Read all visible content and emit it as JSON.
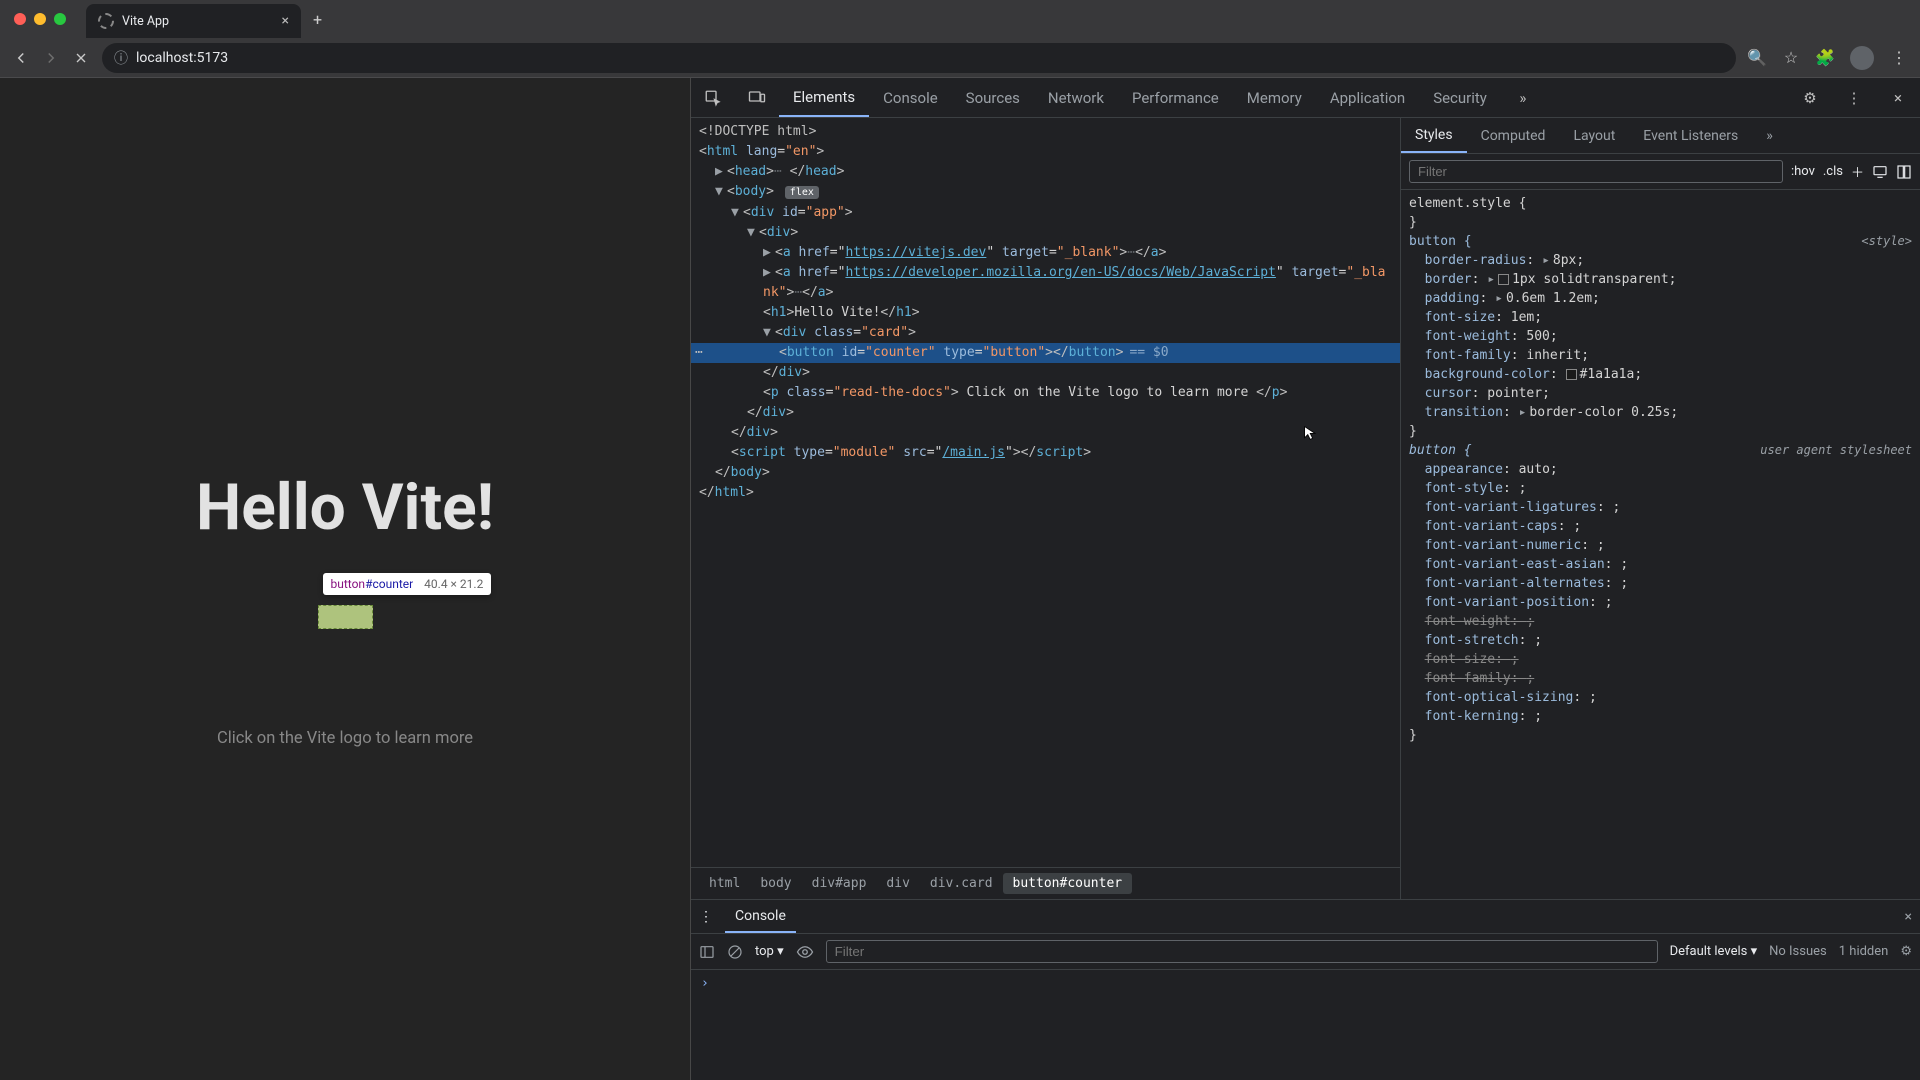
{
  "browser": {
    "window_title": "Vite App",
    "url": "localhost:5173",
    "traffic_light_colors": [
      "#ff5f57",
      "#febc2e",
      "#28c840"
    ]
  },
  "page": {
    "heading": "Hello Vite!",
    "footer": "Click on the Vite logo to learn more",
    "inspect_tooltip_name": "button",
    "inspect_tooltip_id": "#counter",
    "inspect_tooltip_dims": "40.4 × 21.2"
  },
  "devtools": {
    "tabs": [
      "Elements",
      "Console",
      "Sources",
      "Network",
      "Performance",
      "Memory",
      "Application",
      "Security"
    ],
    "active_tab": "Elements",
    "breadcrumb": [
      "html",
      "body",
      "div#app",
      "div",
      "div.card",
      "button#counter"
    ],
    "breadcrumb_active": 5,
    "selected_line_suffix": "== $0",
    "dom": {
      "doctype": "<!DOCTYPE html>",
      "html_open": "<html lang=\"en\">",
      "head": {
        "open": "<head>",
        "close": "</head>"
      },
      "body_open": "<body>",
      "body_badge": "flex",
      "app_open": "<div id=\"app\">",
      "div_open": "<div>",
      "link1_href": "https://vitejs.dev",
      "link2_href": "https://developer.mozilla.org/en-US/docs/Web/JavaScript",
      "target": "_blank",
      "h1_text": "Hello Vite!",
      "card_open": "<div class=\"card\">",
      "button_line": "<button id=\"counter\" type=\"button\"></button>",
      "card_close": "</div>",
      "p_class": "read-the-docs",
      "p_text": "Click on the Vite logo to learn more",
      "div_close": "</div>",
      "script_type": "module",
      "script_src": "/main.js",
      "body_close": "</body>",
      "html_close": "</html>"
    }
  },
  "styles": {
    "tabs": [
      "Styles",
      "Computed",
      "Layout",
      "Event Listeners"
    ],
    "active_tab": "Styles",
    "filter_placeholder": "Filter",
    "toolbar_items": [
      ":hov",
      ".cls"
    ],
    "element_style": "element.style {",
    "rule_button": {
      "selector": "button {",
      "source": "<style>",
      "props": [
        {
          "p": "border-radius",
          "v": "8px",
          "arr": true
        },
        {
          "p": "border",
          "v": "1px solid",
          "arr": true,
          "swatch": "transparent",
          "swatchColor": "#00000000",
          "tail": "transparent"
        },
        {
          "p": "padding",
          "v": "0.6em 1.2em",
          "arr": true
        },
        {
          "p": "font-size",
          "v": "1em"
        },
        {
          "p": "font-weight",
          "v": "500"
        },
        {
          "p": "font-family",
          "v": "inherit"
        },
        {
          "p": "background-color",
          "v": "",
          "swatch": "#1a1a1a",
          "swatchColor": "#1a1a1a",
          "tail": "#1a1a1a"
        },
        {
          "p": "cursor",
          "v": "pointer"
        },
        {
          "p": "transition",
          "v": "border-color 0.25s",
          "arr": true
        }
      ]
    },
    "rule_ua": {
      "selector": "button {",
      "source": "user agent stylesheet",
      "props": [
        {
          "p": "appearance",
          "v": "auto"
        },
        {
          "p": "font-style",
          "v": ""
        },
        {
          "p": "font-variant-ligatures",
          "v": ""
        },
        {
          "p": "font-variant-caps",
          "v": ""
        },
        {
          "p": "font-variant-numeric",
          "v": ""
        },
        {
          "p": "font-variant-east-asian",
          "v": ""
        },
        {
          "p": "font-variant-alternates",
          "v": ""
        },
        {
          "p": "font-variant-position",
          "v": ""
        },
        {
          "p": "font-weight",
          "v": "",
          "strike": true
        },
        {
          "p": "font-stretch",
          "v": ""
        },
        {
          "p": "font-size",
          "v": "",
          "strike": true
        },
        {
          "p": "font-family",
          "v": "",
          "strike": true
        },
        {
          "p": "font-optical-sizing",
          "v": ""
        },
        {
          "p": "font-kerning",
          "v": ""
        }
      ]
    }
  },
  "console": {
    "tab_label": "Console",
    "context": "top",
    "filter_placeholder": "Filter",
    "levels": "Default levels",
    "issues": "No Issues",
    "hidden": "1 hidden"
  }
}
